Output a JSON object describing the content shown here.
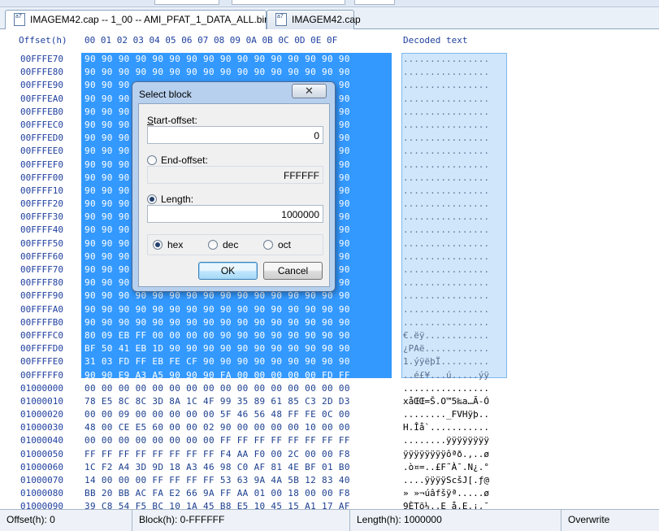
{
  "tabs": [
    {
      "label": "IMAGEM42.cap -- 1_00 -- AMI_PFAT_1_DATA_ALL.bin",
      "active": true
    },
    {
      "label": "IMAGEM42.cap",
      "active": false
    }
  ],
  "tab_icon_text": "a7",
  "hex_header": {
    "offset_label": "Offset(h)",
    "columns": [
      "00",
      "01",
      "02",
      "03",
      "04",
      "05",
      "06",
      "07",
      "08",
      "09",
      "0A",
      "0B",
      "0C",
      "0D",
      "0E",
      "0F"
    ],
    "decoded_label": "Decoded text"
  },
  "rows": [
    {
      "offset": "00FFFE70",
      "hex": "90 90 90 90 90 90 90 90 90 90 90 90 90 90 90 90",
      "decoded": "................",
      "selected": true
    },
    {
      "offset": "00FFFE80",
      "hex": "90 90 90 90 90 90 90 90 90 90 90 90 90 90 90 90",
      "decoded": "................",
      "selected": true
    },
    {
      "offset": "00FFFE90",
      "hex": "90 90 90 90 90 90 90 90 90 90 90 90 90 90 90 90",
      "decoded": "................",
      "selected": true
    },
    {
      "offset": "00FFFEA0",
      "hex": "90 90 90 90 90 90 90 90 90 90 90 90 90 90 90 90",
      "decoded": "................",
      "selected": true
    },
    {
      "offset": "00FFFEB0",
      "hex": "90 90 90 90 90 90 90 90 90 90 90 90 90 90 90 90",
      "decoded": "................",
      "selected": true
    },
    {
      "offset": "00FFFEC0",
      "hex": "90 90 90 90 90 90 90 90 90 90 90 90 90 90 90 90",
      "decoded": "................",
      "selected": true
    },
    {
      "offset": "00FFFED0",
      "hex": "90 90 90 90 90 90 90 90 90 90 90 90 90 90 90 90",
      "decoded": "................",
      "selected": true
    },
    {
      "offset": "00FFFEE0",
      "hex": "90 90 90 90 90 90 90 90 90 90 90 90 90 90 90 90",
      "decoded": "................",
      "selected": true
    },
    {
      "offset": "00FFFEF0",
      "hex": "90 90 90 90 90 90 90 90 90 90 90 90 90 90 90 90",
      "decoded": "................",
      "selected": true
    },
    {
      "offset": "00FFFF00",
      "hex": "90 90 90 90 90 90 90 90 90 90 90 90 90 90 90 90",
      "decoded": "................",
      "selected": true
    },
    {
      "offset": "00FFFF10",
      "hex": "90 90 90 90 90 90 90 90 90 90 90 90 90 90 90 90",
      "decoded": "................",
      "selected": true
    },
    {
      "offset": "00FFFF20",
      "hex": "90 90 90 90 90 90 90 90 90 90 90 90 90 90 90 90",
      "decoded": "................",
      "selected": true
    },
    {
      "offset": "00FFFF30",
      "hex": "90 90 90 90 90 90 90 90 90 90 90 90 90 90 90 90",
      "decoded": "................",
      "selected": true
    },
    {
      "offset": "00FFFF40",
      "hex": "90 90 90 90 90 90 90 90 90 90 90 90 90 90 90 90",
      "decoded": "................",
      "selected": true
    },
    {
      "offset": "00FFFF50",
      "hex": "90 90 90 90 90 90 90 90 90 90 90 90 90 90 90 90",
      "decoded": "................",
      "selected": true
    },
    {
      "offset": "00FFFF60",
      "hex": "90 90 90 90 90 90 90 90 90 90 90 90 90 90 90 90",
      "decoded": "................",
      "selected": true
    },
    {
      "offset": "00FFFF70",
      "hex": "90 90 90 90 90 90 90 90 90 90 90 90 90 90 90 90",
      "decoded": "................",
      "selected": true
    },
    {
      "offset": "00FFFF80",
      "hex": "90 90 90 90 90 90 90 90 90 90 90 90 90 90 90 90",
      "decoded": "................",
      "selected": true
    },
    {
      "offset": "00FFFF90",
      "hex": "90 90 90 90 90 90 90 90 90 90 90 90 90 90 90 90",
      "decoded": "................",
      "selected": true
    },
    {
      "offset": "00FFFFA0",
      "hex": "90 90 90 90 90 90 90 90 90 90 90 90 90 90 90 90",
      "decoded": "................",
      "selected": true
    },
    {
      "offset": "00FFFFB0",
      "hex": "90 90 90 90 90 90 90 90 90 90 90 90 90 90 90 90",
      "decoded": "................",
      "selected": true
    },
    {
      "offset": "00FFFFC0",
      "hex": "80 09 EB FF 00 00 00 00 90 90 90 90 90 90 90 90",
      "decoded": "€.ëÿ............",
      "selected": true
    },
    {
      "offset": "00FFFFD0",
      "hex": "BF 50 41 EB 1D 90 90 90 90 90 90 90 90 90 90 90",
      "decoded": "¿PAë............",
      "selected": true
    },
    {
      "offset": "00FFFFE0",
      "hex": "31 03 FD FF EB FE CF 90 90 90 90 90 90 90 90 90",
      "decoded": "1.ýÿëþÏ.........",
      "selected": true
    },
    {
      "offset": "00FFFFF0",
      "hex": "90 90 E9 A3 A5 90 90 90 FA 00 00 00 00 00 FD FF",
      "decoded": "..é£¥...ú.....ýÿ",
      "selected": true
    },
    {
      "offset": "01000000",
      "hex": "00 00 00 00 00 00 00 00 00 00 00 00 00 00 00 00",
      "decoded": "................",
      "selected": false
    },
    {
      "offset": "01000010",
      "hex": "78 E5 8C 8C 3D 8A 1C 4F 99 35 89 61 85 C3 2D D3",
      "decoded": "xåŒŒ=Š.O™5‰a…Ã-Ó",
      "selected": false
    },
    {
      "offset": "01000020",
      "hex": "00 00 09 00 00 00 00 00 5F 46 56 48 FF FE 0C 00",
      "decoded": "........_FVHÿþ..",
      "selected": false
    },
    {
      "offset": "01000030",
      "hex": "48 00 CE E5 60 00 00 02 90 00 00 00 00 10 00 00",
      "decoded": "H.Îå`...........",
      "selected": false
    },
    {
      "offset": "01000040",
      "hex": "00 00 00 00 00 00 00 00 FF FF FF FF FF FF FF FF",
      "decoded": "........ÿÿÿÿÿÿÿÿ",
      "selected": false
    },
    {
      "offset": "01000050",
      "hex": "FF FF FF FF FF FF FF FF F4 AA F0 00 2C 00 00 F8",
      "decoded": "ÿÿÿÿÿÿÿÿôªð.,..ø",
      "selected": false
    },
    {
      "offset": "01000060",
      "hex": "1C F2 A4 3D 9D 18 A3 46 98 C0 AF 81 4E BF 01 B0",
      "decoded": ".ò¤=..£F˜À¯.N¿.°",
      "selected": false
    },
    {
      "offset": "01000070",
      "hex": "14 00 00 00 FF FF FF FF 53 63 9A 4A 5B 12 83 40",
      "decoded": "....ÿÿÿÿScšJ[.ƒ@",
      "selected": false
    },
    {
      "offset": "01000080",
      "hex": "BB 20 BB AC FA E2 66 9A FF AA 01 00 18 00 00 F8",
      "decoded": "» »¬úâfšÿª.....ø",
      "selected": false
    },
    {
      "offset": "01000090",
      "hex": "39 C8 54 F5 BC 10 1A 45 B8 E5 10 45 15 A1 17 AF",
      "decoded": "9ÈTõ¼..E¸å.E.¡.¯",
      "selected": false
    }
  ],
  "dialog": {
    "title": "Select block",
    "close_glyph": "✕",
    "start_offset": {
      "label_key": "S",
      "label_rest": "tart-offset:",
      "value": "0"
    },
    "end_offset": {
      "label": "End-offset:",
      "value": "FFFFFF",
      "selected": false
    },
    "length": {
      "label": "Length:",
      "value": "1000000",
      "selected": true
    },
    "base": {
      "options": [
        "hex",
        "dec",
        "oct"
      ],
      "selected": "hex"
    },
    "ok_label": "OK",
    "cancel_label": "Cancel"
  },
  "status": {
    "offset": "Offset(h): 0",
    "block": "Block(h): 0-FFFFFF",
    "length": "Length(h): 1000000",
    "mode": "Overwrite"
  }
}
